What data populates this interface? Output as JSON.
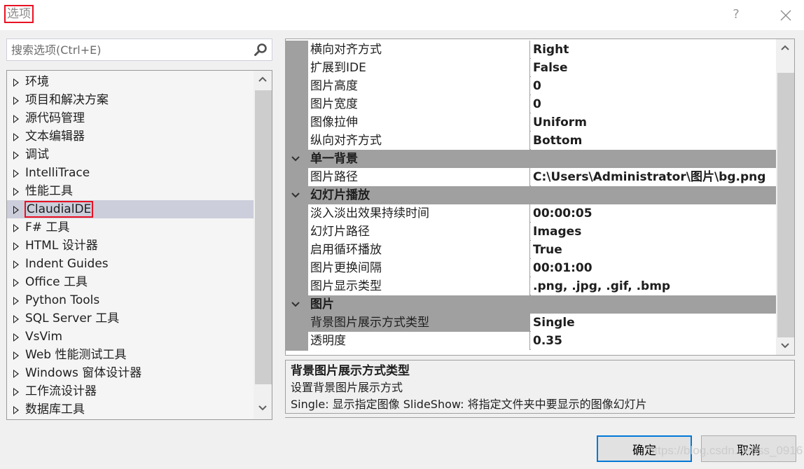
{
  "window": {
    "title": "选项",
    "help_label": "?",
    "close_icon": "close-icon"
  },
  "search": {
    "placeholder": "搜索选项(Ctrl+E)",
    "value": "",
    "icon": "search-icon"
  },
  "tree": {
    "items": [
      {
        "label": "环境",
        "selected": false
      },
      {
        "label": "项目和解决方案",
        "selected": false
      },
      {
        "label": "源代码管理",
        "selected": false
      },
      {
        "label": "文本编辑器",
        "selected": false
      },
      {
        "label": "调试",
        "selected": false
      },
      {
        "label": "IntelliTrace",
        "selected": false
      },
      {
        "label": "性能工具",
        "selected": false
      },
      {
        "label": "ClaudialDE",
        "selected": true
      },
      {
        "label": "F# 工具",
        "selected": false
      },
      {
        "label": "HTML 设计器",
        "selected": false
      },
      {
        "label": "Indent Guides",
        "selected": false
      },
      {
        "label": "Office 工具",
        "selected": false
      },
      {
        "label": "Python Tools",
        "selected": false
      },
      {
        "label": "SQL Server 工具",
        "selected": false
      },
      {
        "label": "VsVim",
        "selected": false
      },
      {
        "label": "Web 性能测试工具",
        "selected": false
      },
      {
        "label": "Windows 窗体设计器",
        "selected": false
      },
      {
        "label": "工作流设计器",
        "selected": false
      },
      {
        "label": "数据库工具",
        "selected": false
      }
    ]
  },
  "property_grid": {
    "rows": [
      {
        "type": "prop",
        "name": "横向对齐方式",
        "value": "Right"
      },
      {
        "type": "prop",
        "name": "扩展到IDE",
        "value": "False"
      },
      {
        "type": "prop",
        "name": "图片高度",
        "value": "0"
      },
      {
        "type": "prop",
        "name": "图片宽度",
        "value": "0"
      },
      {
        "type": "prop",
        "name": "图像拉伸",
        "value": "Uniform"
      },
      {
        "type": "prop",
        "name": "纵向对齐方式",
        "value": "Bottom"
      },
      {
        "type": "category",
        "name": "单一背景"
      },
      {
        "type": "prop",
        "name": "图片路径",
        "value": "C:\\Users\\Administrator\\图片\\bg.png"
      },
      {
        "type": "category",
        "name": "幻灯片播放"
      },
      {
        "type": "prop",
        "name": "淡入淡出效果持续时间",
        "value": "00:00:05"
      },
      {
        "type": "prop",
        "name": "幻灯片路径",
        "value": "Images"
      },
      {
        "type": "prop",
        "name": "启用循环播放",
        "value": "True"
      },
      {
        "type": "prop",
        "name": "图片更换间隔",
        "value": "00:01:00"
      },
      {
        "type": "prop",
        "name": "图片显示类型",
        "value": ".png, .jpg, .gif, .bmp"
      },
      {
        "type": "category",
        "name": "图片"
      },
      {
        "type": "prop",
        "name": "背景图片展示方式类型",
        "value": "Single",
        "selected": true
      },
      {
        "type": "prop",
        "name": "透明度",
        "value": "0.35"
      }
    ]
  },
  "description": {
    "title": "背景图片展示方式类型",
    "line1": "设置背景图片展示方式",
    "line2": "Single: 显示指定图像 SlideShow: 将指定文件夹中要显示的图像幻灯片"
  },
  "buttons": {
    "ok": "确定",
    "cancel": "取消"
  },
  "watermark": "https://blog.csdn.net/ss_0916",
  "colors": {
    "selection": "#cccedb",
    "category_bg": "#a0a0a0",
    "primary_border": "#0078d7",
    "highlight_box": "#e81123"
  }
}
